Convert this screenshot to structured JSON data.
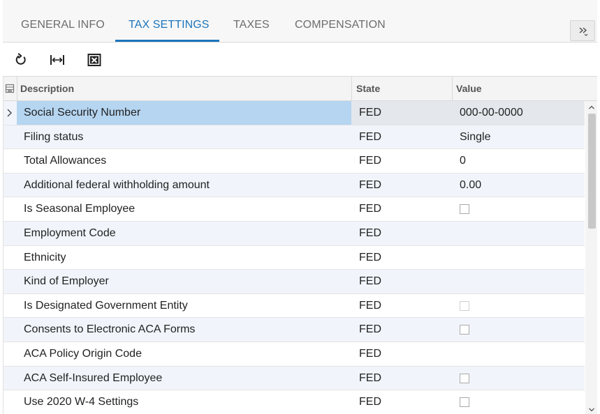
{
  "tabs": [
    {
      "label": "GENERAL INFO",
      "active": false
    },
    {
      "label": "TAX SETTINGS",
      "active": true
    },
    {
      "label": "TAXES",
      "active": false
    },
    {
      "label": "COMPENSATION",
      "active": false
    }
  ],
  "toolbar": {
    "icons": [
      "refresh-icon",
      "fit-columns-icon",
      "export-excel-icon"
    ]
  },
  "grid": {
    "columns": {
      "description": "Description",
      "state": "State",
      "value": "Value"
    },
    "rows": [
      {
        "description": "Social Security Number",
        "state": "FED",
        "value": "000-00-0000"
      },
      {
        "description": "Filing status",
        "state": "FED",
        "value": "Single"
      },
      {
        "description": "Total Allowances",
        "state": "FED",
        "value": "0"
      },
      {
        "description": "Additional federal withholding amount",
        "state": "FED",
        "value": "0.00"
      },
      {
        "description": "Is Seasonal Employee",
        "state": "FED",
        "value": ""
      },
      {
        "description": "Employment Code",
        "state": "FED",
        "value": ""
      },
      {
        "description": "Ethnicity",
        "state": "FED",
        "value": ""
      },
      {
        "description": "Kind of Employer",
        "state": "FED",
        "value": ""
      },
      {
        "description": "Is Designated Government Entity",
        "state": "FED",
        "value": ""
      },
      {
        "description": "Consents to Electronic ACA Forms",
        "state": "FED",
        "value": ""
      },
      {
        "description": "ACA Policy Origin Code",
        "state": "FED",
        "value": ""
      },
      {
        "description": "ACA Self-Insured Employee",
        "state": "FED",
        "value": ""
      },
      {
        "description": "Use 2020 W-4 Settings",
        "state": "FED",
        "value": ""
      }
    ]
  },
  "colors": {
    "accent": "#1c75bc",
    "selected_row": "#b5d5f1",
    "alt_row": "#f1f5fb"
  }
}
